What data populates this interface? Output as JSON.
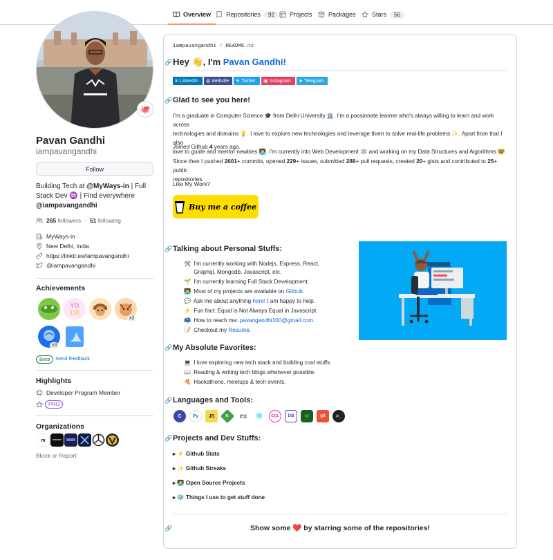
{
  "nav": {
    "tabs": [
      {
        "label": "Overview",
        "count": ""
      },
      {
        "label": "Repositories",
        "count": "92"
      },
      {
        "label": "Projects",
        "count": ""
      },
      {
        "label": "Packages",
        "count": ""
      },
      {
        "label": "Stars",
        "count": "56"
      }
    ]
  },
  "profile": {
    "name": "Pavan Gandhi",
    "login": "iampavangandhi",
    "follow_label": "Follow",
    "status_emoji": "🐙",
    "bio_prefix": "Building Tech at ",
    "bio_org": "@MyWays-in",
    "bio_mid": " | Full Stack Dev ♒ | Find everywhere ",
    "bio_handle": "@iampavangandhi",
    "followers_count": "265",
    "followers_label": "followers",
    "separator": "·",
    "following_count": "51",
    "following_label": "following",
    "company": "MyWays-in",
    "location": "New Delhi, India",
    "website": "https://linktr.ee/iampavangandhi",
    "twitter": "@iampavangandhi"
  },
  "achievements": {
    "title": "Achievements",
    "badge_x2": "x2",
    "badge_x3": "x3",
    "beta": "Beta",
    "feedback": "Send feedback"
  },
  "highlights": {
    "title": "Highlights",
    "item": "Developer Program Member",
    "pro": "PRO"
  },
  "organizations": {
    "title": "Organizations",
    "block": "Block or Report"
  },
  "readme": {
    "path_user": "iampavangandhi",
    "path_sep": " / ",
    "path_file": "README",
    "path_ext": ".md",
    "greeting": "Hey 👋, I'm ",
    "greeting_name": "Pavan Gandhi!",
    "badges": [
      {
        "label": "LinkedIn",
        "color": "#0077b5"
      },
      {
        "label": "Website",
        "color": "#3e4e8f"
      },
      {
        "label": "Twitter",
        "color": "#1da1f2"
      },
      {
        "label": "Instagram",
        "color": "#e4405f"
      },
      {
        "label": "Telegram",
        "color": "#2ca5e0"
      }
    ],
    "glad_title": "Glad to see you here!",
    "intro_1": "I'm a graduate in Computer Science 🎓 from Delhi University 🏛️. I'm a passionate learner who's always willing to learn and work across",
    "intro_2": "technologies and domains 💡. I love to explore new technologies and leverage them to solve real-life problems ✨. Apart from that I also",
    "intro_3": "love to guide and mentor newbies 👨‍💻. I'm currently into Web Development 🕸️ and working on my Data Structures and Algorithms 🤓.",
    "joined_prefix": "Joined Github ",
    "joined_years": "4",
    "joined_suffix": " years ago.",
    "stats_a": "Since then I pushed ",
    "stats_commits": "2601",
    "stats_b": "+ commits, opened ",
    "stats_issues": "229",
    "stats_c": "+ issues, submitted ",
    "stats_prs": "288",
    "stats_d": "+ pull requests, created ",
    "stats_gists": "20",
    "stats_e": "+ gists and contributed to ",
    "stats_repos": "25",
    "stats_f": "+ public",
    "stats_g": "repositories.",
    "like": "Like My Work?",
    "coffee": "Buy me a coffee",
    "personal_title": "Talking about Personal Stuffs:",
    "personal_items": [
      {
        "e": "🛠️",
        "t": "I'm currently working with Nodejs, Express, React,"
      },
      {
        "e": "",
        "t": "Graphql, Mongodb, Javascript, etc."
      },
      {
        "e": "🌱",
        "t": "I'm currently learning Full Stack Development."
      },
      {
        "e": "👨‍💻",
        "t": "Most of my projects are available on "
      },
      {
        "e": "💬",
        "t": "Ask me about anything "
      },
      {
        "e": "⚡",
        "t": "Fun fact: Equal is Not Always Equal in Javascript."
      },
      {
        "e": "📫",
        "t": "How to reach me: "
      },
      {
        "e": "📝",
        "t": "Checkout my "
      }
    ],
    "github_link": "Github",
    "here_link": "here!",
    "happy": " I am happy to help.",
    "email_link": "pavangandhi100@gmail.com",
    "dot": ".",
    "resume_link": "Resume",
    "fav_title": "My Absolute Favorites:",
    "fav_items": [
      {
        "e": "💻",
        "t": "I love exploring new tech stack and building cool stuffs."
      },
      {
        "e": "📖",
        "t": "Reading & writing tech blogs whenever possible."
      },
      {
        "e": "🍕",
        "t": "Hackathons, meetups & tech events."
      }
    ],
    "lang_title": "Languages and Tools:",
    "tools": [
      {
        "label": "C",
        "color": "#3949ab"
      },
      {
        "label": "Py",
        "color": "#3776ab"
      },
      {
        "label": "JS",
        "color": "#f0db4f"
      },
      {
        "label": "N",
        "color": "#43a047"
      },
      {
        "label": "ex",
        "color": "#ffffff"
      },
      {
        "label": "⚛",
        "color": "#61dafb"
      },
      {
        "label": "GQL",
        "color": "#e535ab"
      },
      {
        "label": "DB",
        "color": "#3f51b5"
      },
      {
        "label": "M",
        "color": "#4db33d"
      },
      {
        "label": "git",
        "color": "#f05032"
      },
      {
        "label": ">_",
        "color": "#1f2328"
      }
    ],
    "proj_title": "Projects and Dev Stuffs:",
    "details": [
      {
        "e": "⚡",
        "t": "Github Stats"
      },
      {
        "e": "✨",
        "t": "Github Streaks"
      },
      {
        "e": "🧑‍💻",
        "t": "Open Source Projects"
      },
      {
        "e": "⚙️",
        "t": "Things I use to get stuff done"
      }
    ],
    "show_a": "Show some ",
    "show_heart": "❤️",
    "show_b": " by starring some of the repositories!"
  }
}
